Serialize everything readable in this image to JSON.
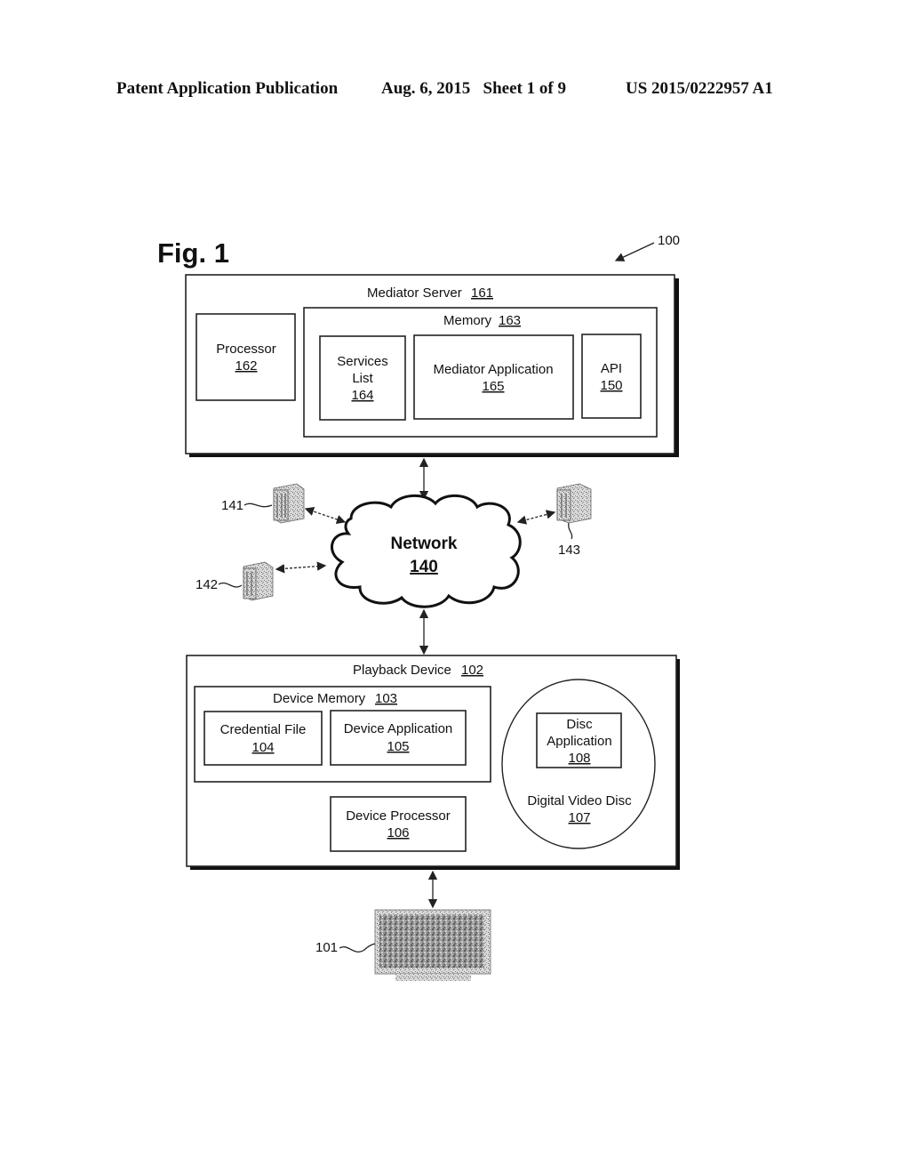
{
  "header": {
    "publication": "Patent Application Publication",
    "date_sheet": "Aug. 6, 2015   Sheet 1 of 9",
    "number": "US 2015/0222957 A1"
  },
  "figure": {
    "title": "Fig. 1",
    "ref": "100"
  },
  "mediator_server": {
    "label": "Mediator Server",
    "num": "161",
    "processor": {
      "label": "Processor",
      "num": "162"
    },
    "memory": {
      "label": "Memory",
      "num": "163",
      "services_list": {
        "line1": "Services",
        "line2": "List",
        "num": "164"
      },
      "mediator_application": {
        "label": "Mediator Application",
        "num": "165"
      },
      "api": {
        "label": "API",
        "num": "150"
      }
    }
  },
  "network": {
    "label": "Network",
    "num": "140"
  },
  "servers": [
    {
      "ref": "141"
    },
    {
      "ref": "142"
    },
    {
      "ref": "143"
    }
  ],
  "playback_device": {
    "label": "Playback Device",
    "num": "102",
    "device_memory": {
      "label": "Device Memory",
      "num": "103",
      "credential_file": {
        "label": "Credential File",
        "num": "104"
      },
      "device_application": {
        "label": "Device Application",
        "num": "105"
      }
    },
    "device_processor": {
      "label": "Device Processor",
      "num": "106"
    },
    "dvd": {
      "label": "Digital Video Disc",
      "num": "107",
      "disc_application": {
        "line1": "Disc",
        "line2": "Application",
        "num": "108"
      }
    }
  },
  "display": {
    "ref": "101"
  }
}
